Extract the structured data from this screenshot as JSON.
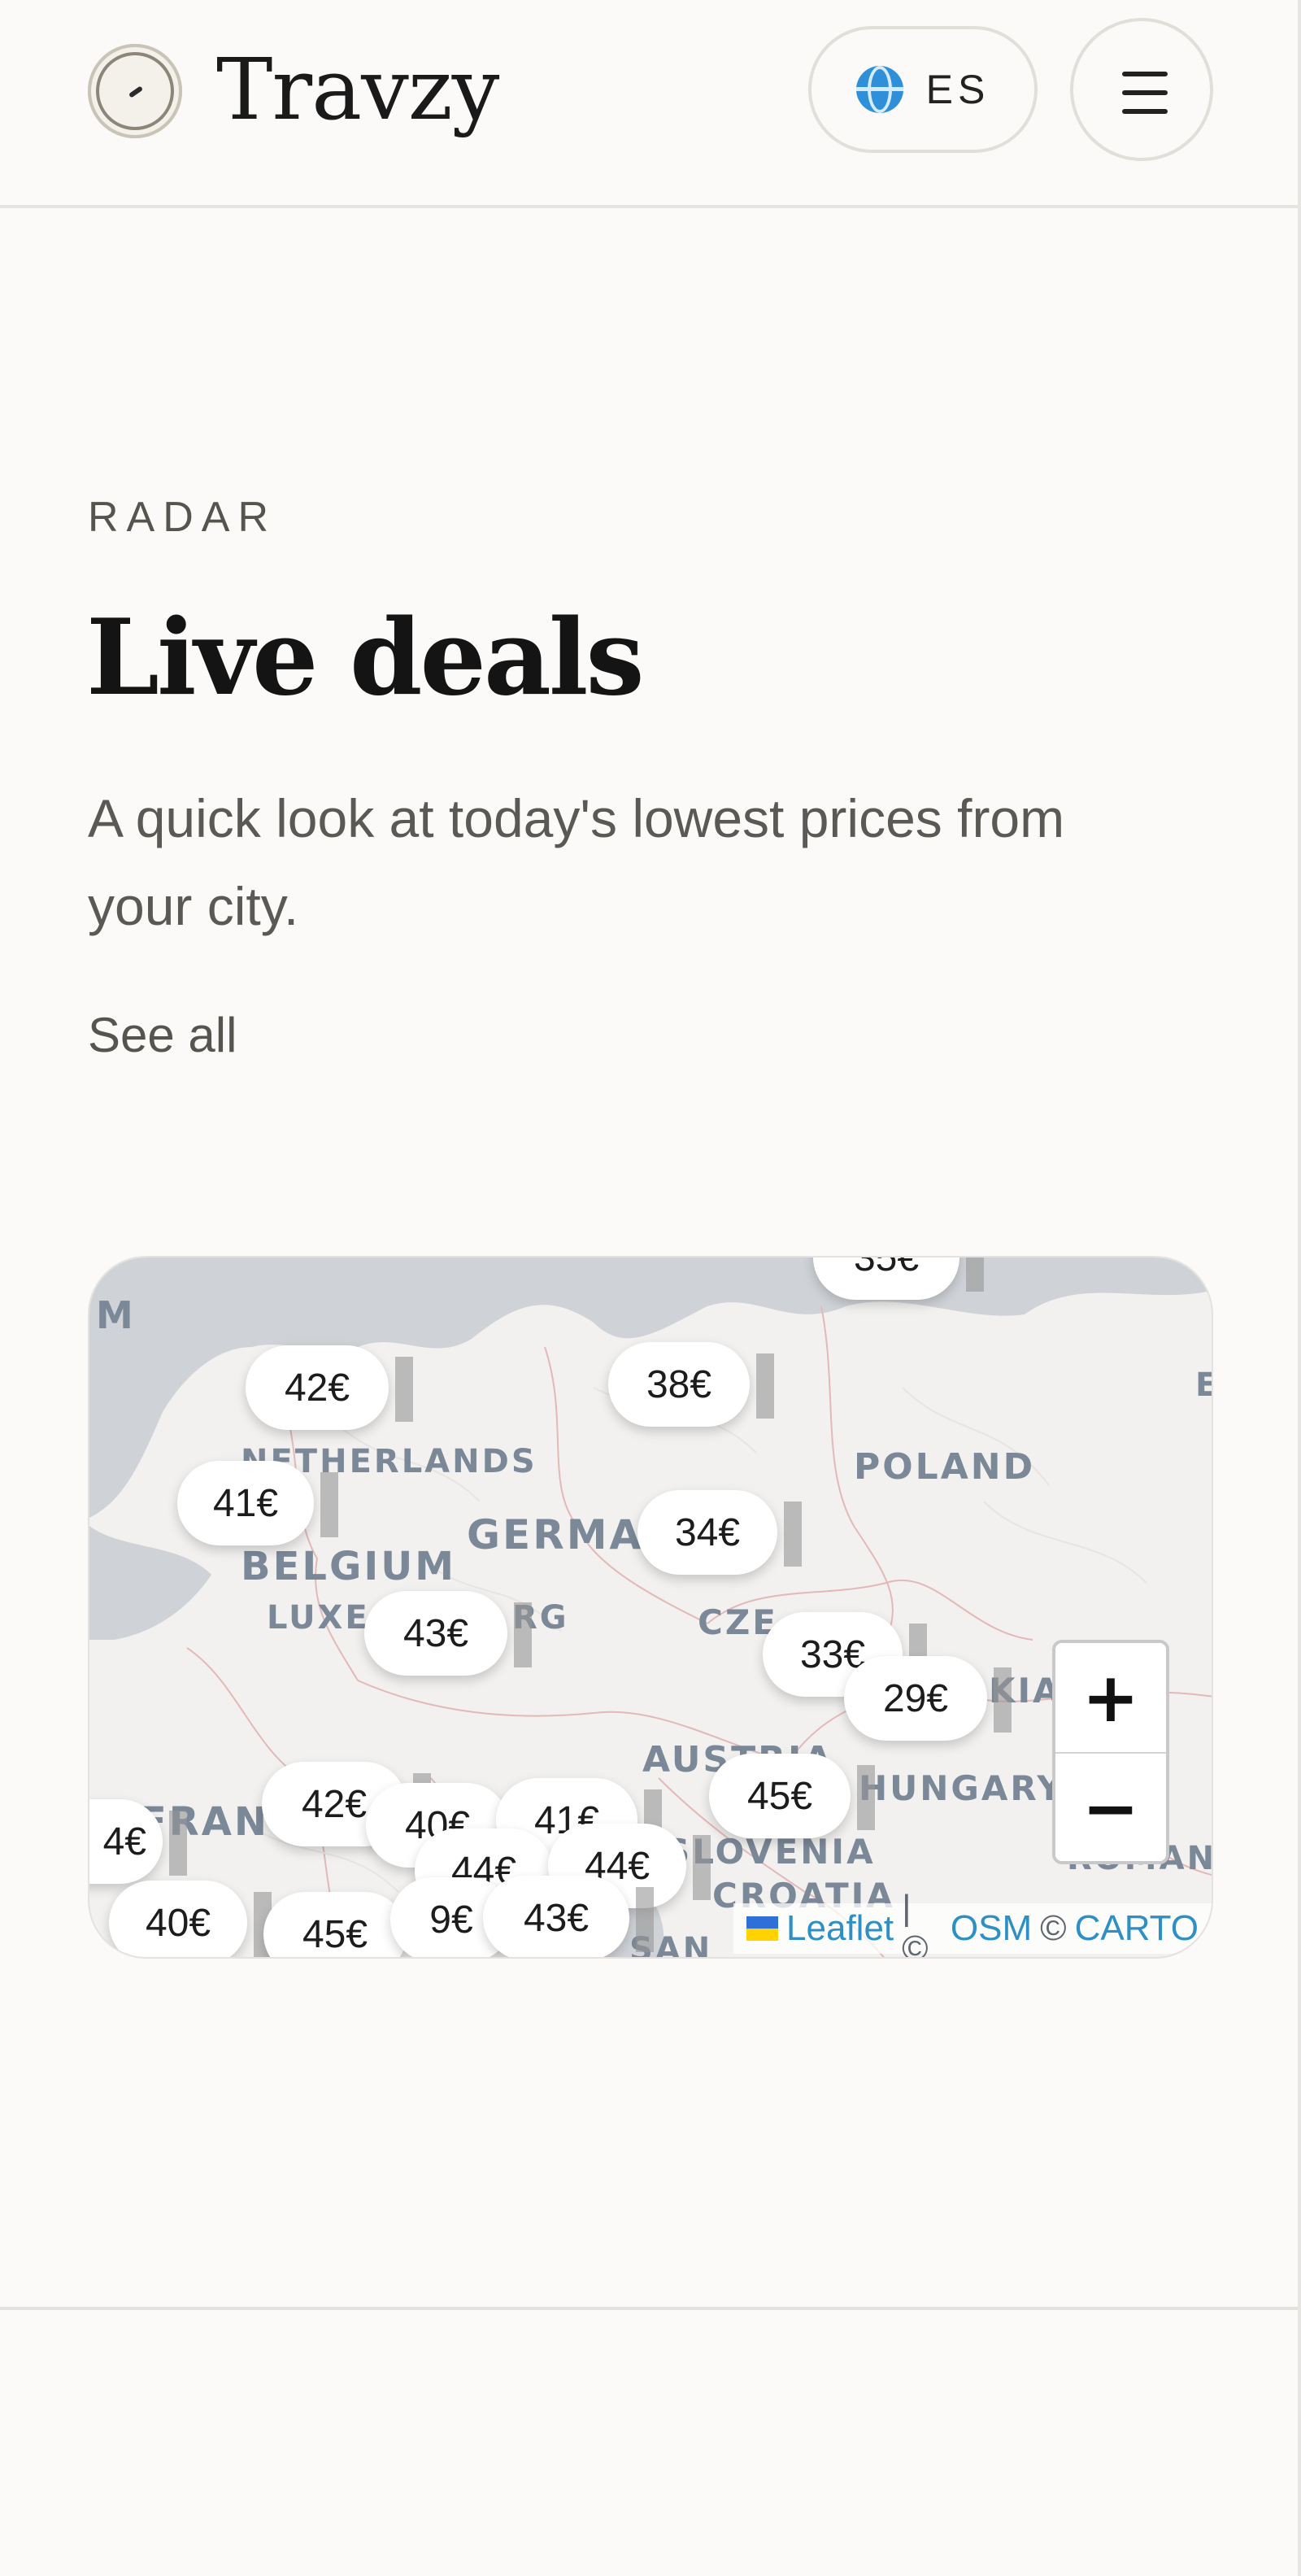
{
  "header": {
    "brand": "Travzy",
    "language_label": "ES"
  },
  "section": {
    "eyebrow": "RADAR",
    "title": "Live deals",
    "subtitle": "A quick look at today's lowest prices from your city.",
    "see_all": "See all"
  },
  "map": {
    "countries": [
      "M",
      "NETHERLANDS",
      "BELGIUM",
      "LUXE",
      "RG",
      "GERMA",
      "POLAND",
      "CZE",
      "KIA",
      "AUSTRIA",
      "HUNGARY",
      "FRAN",
      "SLOVENIA",
      "CROATIA",
      "SAN",
      "E",
      "ROMAN"
    ],
    "prices": [
      "42€",
      "38€",
      "41€",
      "34€",
      "43€",
      "33€",
      "29€",
      "42€",
      "40€",
      "41€",
      "44€",
      "44€",
      "45€",
      "40€",
      "45€",
      "9€",
      "43€",
      "4€",
      "35€"
    ],
    "zoom_in": "+",
    "zoom_out": "−",
    "attribution": {
      "leaflet": "Leaflet",
      "separator": "| ©",
      "osm": "OSM",
      "copy2": "©",
      "carto": "CARTO"
    }
  }
}
